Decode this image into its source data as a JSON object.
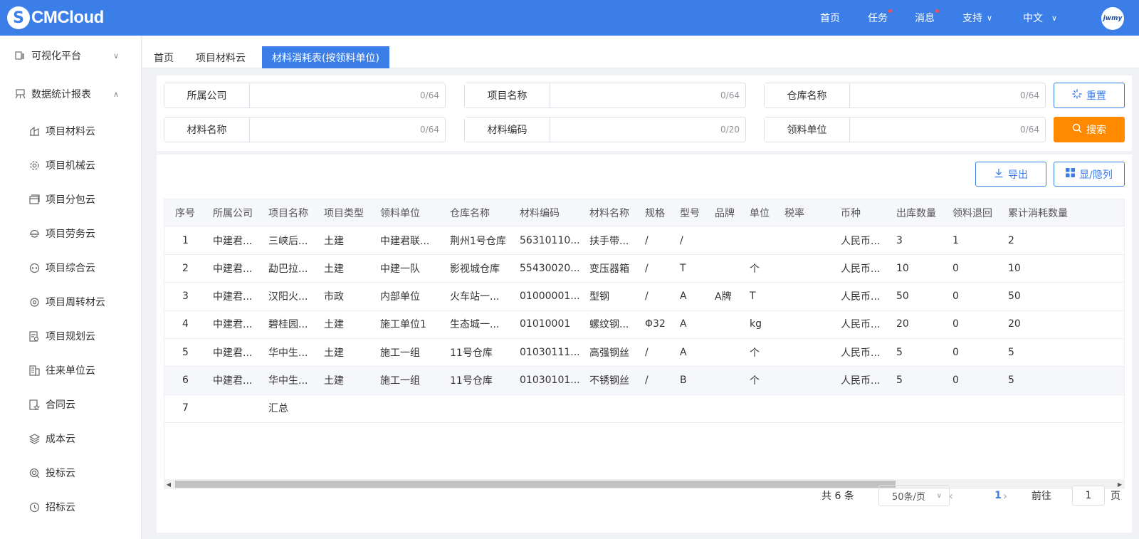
{
  "header": {
    "logo_text": "CMCloud",
    "nav": [
      {
        "label": "首页",
        "dot": false,
        "caret": false
      },
      {
        "label": "任务",
        "dot": true,
        "caret": false
      },
      {
        "label": "消息",
        "dot": true,
        "caret": false
      },
      {
        "label": "支持",
        "dot": false,
        "caret": true
      },
      {
        "label": "中文",
        "dot": false,
        "caret": true
      }
    ],
    "avatar_text": "jwmy"
  },
  "sidebar": {
    "groups": [
      {
        "label": "可视化平台",
        "icon": "platform-icon",
        "expanded": false
      },
      {
        "label": "数据统计报表",
        "icon": "report-icon",
        "expanded": true
      }
    ],
    "items": [
      {
        "label": "项目材料云",
        "icon": "material-icon"
      },
      {
        "label": "项目机械云",
        "icon": "gear-icon"
      },
      {
        "label": "项目分包云",
        "icon": "subcontract-icon"
      },
      {
        "label": "项目劳务云",
        "icon": "helmet-icon"
      },
      {
        "label": "项目综合云",
        "icon": "integrated-icon"
      },
      {
        "label": "项目周转材云",
        "icon": "turnover-icon"
      },
      {
        "label": "项目规划云",
        "icon": "planning-icon"
      },
      {
        "label": "往来单位云",
        "icon": "building-icon"
      },
      {
        "label": "合同云",
        "icon": "contract-icon"
      },
      {
        "label": "成本云",
        "icon": "layers-icon"
      },
      {
        "label": "投标云",
        "icon": "bid-icon"
      },
      {
        "label": "招标云",
        "icon": "tender-icon"
      }
    ]
  },
  "tabs": [
    {
      "label": "首页",
      "active": false
    },
    {
      "label": "项目材料云",
      "active": false
    },
    {
      "label": "材料消耗表(按领料单位)",
      "active": true
    }
  ],
  "filters": [
    {
      "label": "所属公司",
      "value": "",
      "count": "0/64"
    },
    {
      "label": "项目名称",
      "value": "",
      "count": "0/64"
    },
    {
      "label": "仓库名称",
      "value": "",
      "count": "0/64"
    },
    {
      "label": "材料名称",
      "value": "",
      "count": "0/64"
    },
    {
      "label": "材料编码",
      "value": "",
      "count": "0/20"
    },
    {
      "label": "领料单位",
      "value": "",
      "count": "0/64"
    }
  ],
  "buttons": {
    "reset": "重置",
    "search": "搜索",
    "export": "导出",
    "columns": "显/隐列"
  },
  "table": {
    "columns": [
      "序号",
      "所属公司",
      "项目名称",
      "项目类型",
      "领料单位",
      "仓库名称",
      "材料编码",
      "材料名称",
      "规格",
      "型号",
      "品牌",
      "单位",
      "税率",
      "币种",
      "出库数量",
      "领料退回",
      "累计消耗数量"
    ],
    "rows": [
      [
        "1",
        "中建君...",
        "三峡后...",
        "土建",
        "中建君联...",
        "荆州1号仓库",
        "56310110...",
        "扶手带...",
        "/",
        "/",
        "",
        "",
        "",
        "人民币...",
        "3",
        "1",
        "2"
      ],
      [
        "2",
        "中建君...",
        "勐巴拉...",
        "土建",
        "中建一队",
        "影视城仓库",
        "55430020...",
        "变压器箱",
        "/",
        "T",
        "",
        "个",
        "",
        "人民币...",
        "10",
        "0",
        "10"
      ],
      [
        "3",
        "中建君...",
        "汉阳火...",
        "市政",
        "内部单位",
        "火车站一...",
        "01000001...",
        "型钢",
        "/",
        "A",
        "A牌",
        "T",
        "",
        "人民币...",
        "50",
        "0",
        "50"
      ],
      [
        "4",
        "中建君...",
        "碧桂园...",
        "土建",
        "施工单位1",
        "生态城一...",
        "01010001",
        "螺纹钢...",
        "Φ32",
        "A",
        "",
        "kg",
        "",
        "人民币...",
        "20",
        "0",
        "20"
      ],
      [
        "5",
        "中建君...",
        "华中生...",
        "土建",
        "施工一组",
        "11号仓库",
        "01030111...",
        "高强钢丝",
        "/",
        "A",
        "",
        "个",
        "",
        "人民币...",
        "5",
        "0",
        "5"
      ],
      [
        "6",
        "中建君...",
        "华中生...",
        "土建",
        "施工一组",
        "11号仓库",
        "01030101...",
        "不锈钢丝",
        "/",
        "B",
        "",
        "个",
        "",
        "人民币...",
        "5",
        "0",
        "5"
      ],
      [
        "7",
        "",
        "汇总",
        "",
        "",
        "",
        "",
        "",
        "",
        "",
        "",
        "",
        "",
        "",
        "",
        "",
        ""
      ]
    ],
    "highlighted_row": 6
  },
  "pagination": {
    "total": "共 6 条",
    "page_size": "50条/页",
    "current_page": "1",
    "goto_label": "前往",
    "goto_value": "1",
    "page_suffix": "页"
  }
}
